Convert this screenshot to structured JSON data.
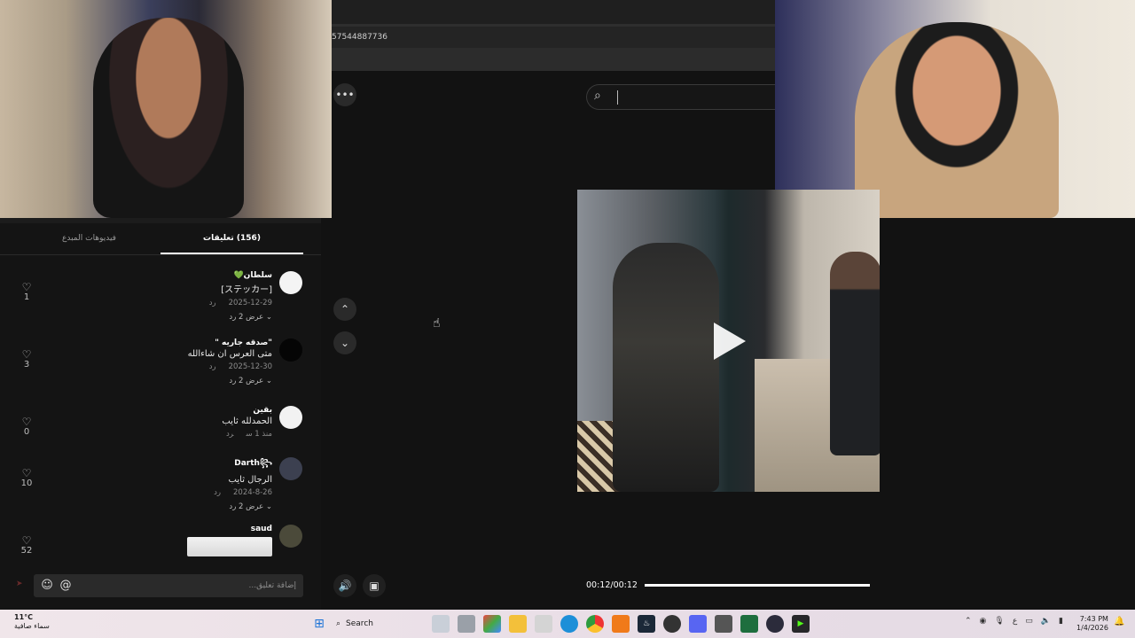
{
  "browser": {
    "url_fragment": "57544887736"
  },
  "comments_panel": {
    "tabs": [
      {
        "label": "(156) تعليقات",
        "active": true
      },
      {
        "label": "فيديوهات المبدع",
        "active": false
      }
    ],
    "comments": [
      {
        "user": "سلطان💚",
        "text": "[ステッカー]",
        "date": "2025-12-29",
        "reply_label": "رد",
        "replies": "عرض 2 رد",
        "likes": "1"
      },
      {
        "user": "\"صدقه جاريه \"",
        "text": "متى العرس ان شاءالله",
        "date": "2025-12-30",
        "reply_label": "رد",
        "replies": "عرض 2 رد",
        "likes": "3"
      },
      {
        "user": "بقين",
        "text": "الحمدلله ثايب",
        "date": "منذ 1 س",
        "reply_label": "رد",
        "replies": "",
        "likes": "0"
      },
      {
        "user": "Darth꧂",
        "text": "الرجال ثايب",
        "date": "2024-8-26",
        "reply_label": "رد",
        "replies": "عرض 2 رد",
        "likes": "10"
      },
      {
        "user": "saud",
        "text": "",
        "date": "",
        "reply_label": "",
        "replies": "",
        "likes": "52"
      }
    ],
    "input_placeholder": "إضافة تعليق..."
  },
  "player": {
    "time": "00:12/00:12",
    "progress": 1.0
  },
  "taskbar": {
    "temp": "11°C",
    "weather": "سماء صافية",
    "search_label": "Search",
    "time": "7:43 PM",
    "date": "1/4/2026"
  }
}
